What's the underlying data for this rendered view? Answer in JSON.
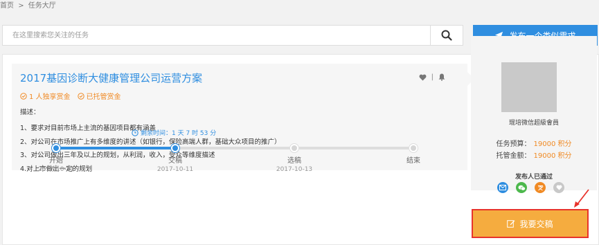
{
  "breadcrumb": {
    "home": "首页",
    "sep": ">",
    "current": "任务大厅"
  },
  "search": {
    "placeholder": "在这里搜索您关注的任务"
  },
  "publish_button": "发布一个类似需求",
  "task": {
    "title": "2017基因诊断大健康管理公司运营方案",
    "tags": [
      "1 人独享赏金",
      "已托管赏金"
    ],
    "desc_label": "描述：",
    "desc_lines": [
      "1、要求对目前市场上主流的基因项目都有涵盖",
      "2、对公司在市场推广上有多维度的讲述（如银行，保险高端人群，基础大众项目的推广）",
      "3、对公司做出三年及以上的规划，从利润，收入，受众等维度描述",
      "4.对上市做出一定的规划"
    ],
    "action_sep": "|"
  },
  "countdown": "剩余时间：1 天 7 时 53 分",
  "timeline": {
    "steps": [
      {
        "name": "开始",
        "date": "2017-10-11"
      },
      {
        "name": "交稿",
        "date": "2017-10-11"
      },
      {
        "name": "选稿",
        "date": "2017-10-13"
      },
      {
        "name": "结束",
        "date": ""
      }
    ],
    "active_steps": 2
  },
  "publisher": {
    "name": "琨培微信超級會員",
    "budget_label": "任务预算：",
    "budget_value": "19000 积分",
    "escrow_label": "托管金额：",
    "escrow_value": "19000 积分",
    "verified_label": "发布人已通过",
    "verify_icons": [
      "email-icon",
      "wechat-icon",
      "id-card-icon",
      "heart-icon"
    ]
  },
  "submit_button": "我要交稿",
  "colors": {
    "primary": "#2f8ee0",
    "accent": "#f08a24",
    "submit": "#f5ac3f",
    "highlight": "#e8332b"
  }
}
